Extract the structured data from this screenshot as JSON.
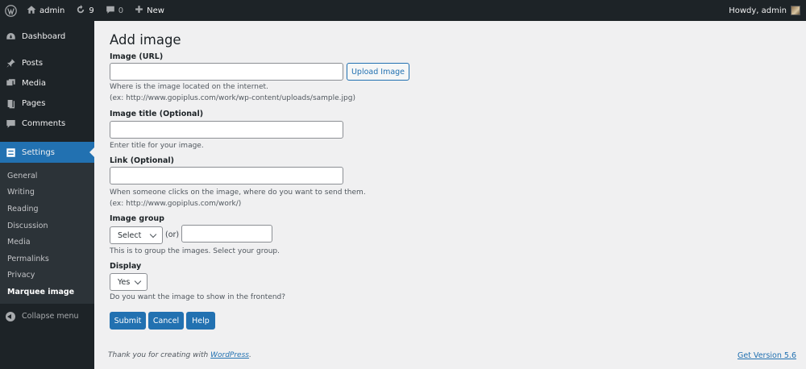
{
  "adminbar": {
    "site_name": "admin",
    "updates_count": "9",
    "comments_count": "0",
    "new_label": "New",
    "greeting": "Howdy, admin"
  },
  "sidebar": {
    "items": [
      {
        "label": "Dashboard",
        "icon": "dashboard-icon"
      },
      {
        "label": "Posts",
        "icon": "pin-icon"
      },
      {
        "label": "Media",
        "icon": "media-icon"
      },
      {
        "label": "Pages",
        "icon": "pages-icon"
      },
      {
        "label": "Comments",
        "icon": "comment-icon"
      }
    ],
    "current": {
      "label": "Settings",
      "icon": "settings-icon"
    },
    "submenu": [
      "General",
      "Writing",
      "Reading",
      "Discussion",
      "Media",
      "Permalinks",
      "Privacy",
      "Marquee image"
    ],
    "submenu_active": "Marquee image",
    "collapse_label": "Collapse menu"
  },
  "form": {
    "title": "Add image",
    "image_url": {
      "label": "Image (URL)",
      "value": "",
      "desc1": "Where is the image located on the internet.",
      "desc2": "(ex: http://www.gopiplus.com/work/wp-content/uploads/sample.jpg)"
    },
    "upload_button": "Upload Image",
    "image_title": {
      "label": "Image title (Optional)",
      "value": "",
      "desc": "Enter title for your image."
    },
    "link": {
      "label": "Link (Optional)",
      "value": "",
      "desc1": "When someone clicks on the image, where do you want to send them.",
      "desc2": "(ex: http://www.gopiplus.com/work/)"
    },
    "group": {
      "label": "Image group",
      "selected": "Select",
      "or_label": "(or)",
      "value": "",
      "desc": "This is to group the images. Select your group."
    },
    "display": {
      "label": "Display",
      "selected": "Yes",
      "desc": "Do you want the image to show in the frontend?"
    },
    "buttons": {
      "submit": "Submit",
      "cancel": "Cancel",
      "help": "Help"
    }
  },
  "footer": {
    "thanks_prefix": "Thank you for creating with ",
    "thanks_link": "WordPress",
    "thanks_suffix": ".",
    "version_link": "Get Version 5.6"
  },
  "colors": {
    "accent": "#2271b1",
    "sidebar_bg": "#1d2327",
    "content_bg": "#f0f0f1"
  }
}
